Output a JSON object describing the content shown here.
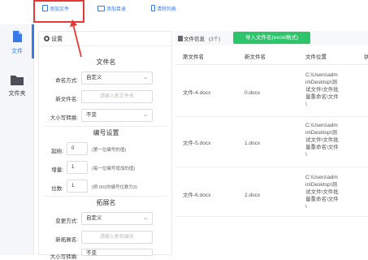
{
  "toolbar": {
    "add_file": "添加文件",
    "add_folder": "添加目录",
    "clear_list": "清除列表"
  },
  "nav": {
    "items": [
      {
        "label": "文件",
        "icon": "file-icon",
        "active": true
      },
      {
        "label": "文件夹",
        "icon": "folder-icon",
        "active": false
      }
    ]
  },
  "settings": {
    "header": "设置",
    "filename_section": {
      "title": "文件名",
      "naming_label": "命名方式:",
      "naming_value": "自定义",
      "newname_label": "新文件名:",
      "newname_placeholder": "请输入新文件名",
      "case_label": "大小写转换:",
      "case_value": "不变"
    },
    "number_section": {
      "title": "编号设置",
      "start_label": "起始:",
      "start_value": "0",
      "start_hint": "(第一位编号的值)",
      "step_label": "增量:",
      "step_value": "1",
      "step_hint": "(每一位编号增加的值)",
      "digits_label": "位数:",
      "digits_value": "1",
      "digits_hint": "(例:001的编号位数为3)"
    },
    "ext_section": {
      "title": "拓展名",
      "change_label": "变更方式:",
      "change_value": "自定义",
      "newext_label": "新拓展名:",
      "newext_placeholder": "请输入新拓展名",
      "case_label": "大小写转换:",
      "case_value": "不变"
    }
  },
  "file_panel": {
    "info_label": "文件信息",
    "count": "(3个)",
    "import_button": "导入文件名(excel格式)",
    "columns": [
      "原文件名",
      "新文件名",
      "文件位置",
      "状"
    ],
    "rows": [
      {
        "original": "文件-4.docx",
        "new": "0.docx",
        "location": [
          "C:\\Users\\adm",
          "in\\Desktop\\测",
          "试文件\\文件批",
          "量重命名\\文件",
          "\\"
        ]
      },
      {
        "original": "文件-5.docx",
        "new": "1.docx",
        "location": [
          "C:\\Users\\adm",
          "in\\Desktop\\测",
          "试文件\\文件批",
          "量重命名\\文件",
          "\\"
        ]
      },
      {
        "original": "文件-6.docx",
        "new": "2.docx",
        "location": [
          "C:\\Users\\adm",
          "in\\Desktop\\测",
          "试文件\\文件批",
          "量重命名\\文件",
          "\\"
        ]
      }
    ]
  }
}
